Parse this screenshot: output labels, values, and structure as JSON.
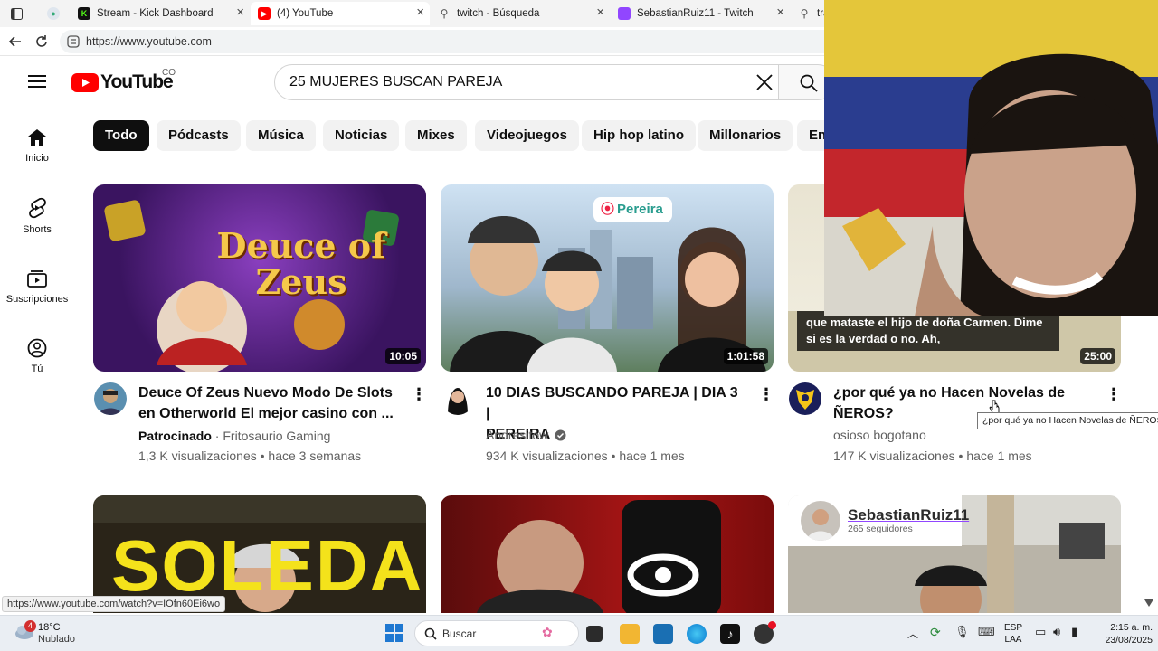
{
  "browser": {
    "tabs": [
      {
        "label": "",
        "active": false
      },
      {
        "label": "Stream - Kick Dashboard",
        "active": false
      },
      {
        "label": "(4) YouTube",
        "active": true
      },
      {
        "label": "twitch - Búsqueda",
        "active": false
      },
      {
        "label": "SebastianRuiz11 - Twitch",
        "active": false
      },
      {
        "label": "tra",
        "active": false
      }
    ],
    "url": "https://www.youtube.com",
    "status_url": "https://www.youtube.com/watch?v=IOfn60Ei6wo"
  },
  "youtube": {
    "logo_text": "YouTube",
    "country": "CO",
    "search_value": "25 MUJERES BUSCAN PAREJA",
    "chips": [
      "Todo",
      "Pódcasts",
      "Música",
      "Noticias",
      "Mixes",
      "Videojuegos",
      "Hip hop latino",
      "Millonarios",
      "En"
    ],
    "nav": [
      {
        "label": "Inicio",
        "icon": "home-icon"
      },
      {
        "label": "Shorts",
        "icon": "shorts-icon"
      },
      {
        "label": "Suscripciones",
        "icon": "subscriptions-icon"
      },
      {
        "label": "Tú",
        "icon": "you-icon"
      }
    ],
    "videos": [
      {
        "title_line1": "Deuce Of Zeus Nuevo Modo De Slots",
        "title_line2": "en Otherworld El mejor casino con ...",
        "sponsored": "Patrocinado",
        "channel": "Fritosaurio Gaming",
        "meta": "1,3 K visualizaciones • hace 3 semanas",
        "duration": "10:05",
        "thumb_text_1": "Deuce of",
        "thumb_text_2": "Zeus"
      },
      {
        "title_line1": "10 DIAS BUSCANDO PAREJA | DIA 3 |",
        "title_line2": "PEREIRA",
        "channel": "Andresitow",
        "meta": "934 K visualizaciones • hace 1 mes",
        "duration": "1:01:58",
        "thumb_text_1": "Pereira"
      },
      {
        "title_line1": "¿por qué ya no Hacen Novelas de",
        "title_line2": "ÑEROS?",
        "channel": "osioso bogotano",
        "meta": "147 K visualizaciones • hace 1 mes",
        "duration": "25:00",
        "thumb_text_1": "que mataste el hijo de doña Carmen. Dime",
        "thumb_text_2": "si es la verdad o no. Ah,"
      }
    ],
    "row2": [
      {
        "thumb_text": "SOLEDAD"
      },
      {
        "thumb_text": ""
      },
      {
        "overlay_name": "SebastianRuiz11",
        "overlay_followers": "265 seguidores"
      }
    ],
    "tooltip": "¿por qué ya no Hacen Novelas de ÑEROS?"
  },
  "taskbar": {
    "weather_temp": "18°C",
    "weather_desc": "Nublado",
    "weather_badge": "4",
    "search_placeholder": "Buscar",
    "lang_1": "ESP",
    "lang_2": "LAA",
    "time": "2:15 a. m.",
    "date": "23/08/2025"
  },
  "colors": {
    "yt_red": "#ff0000",
    "chip_active": "#0f0f0f",
    "chip_bg": "#f2f2f2"
  }
}
